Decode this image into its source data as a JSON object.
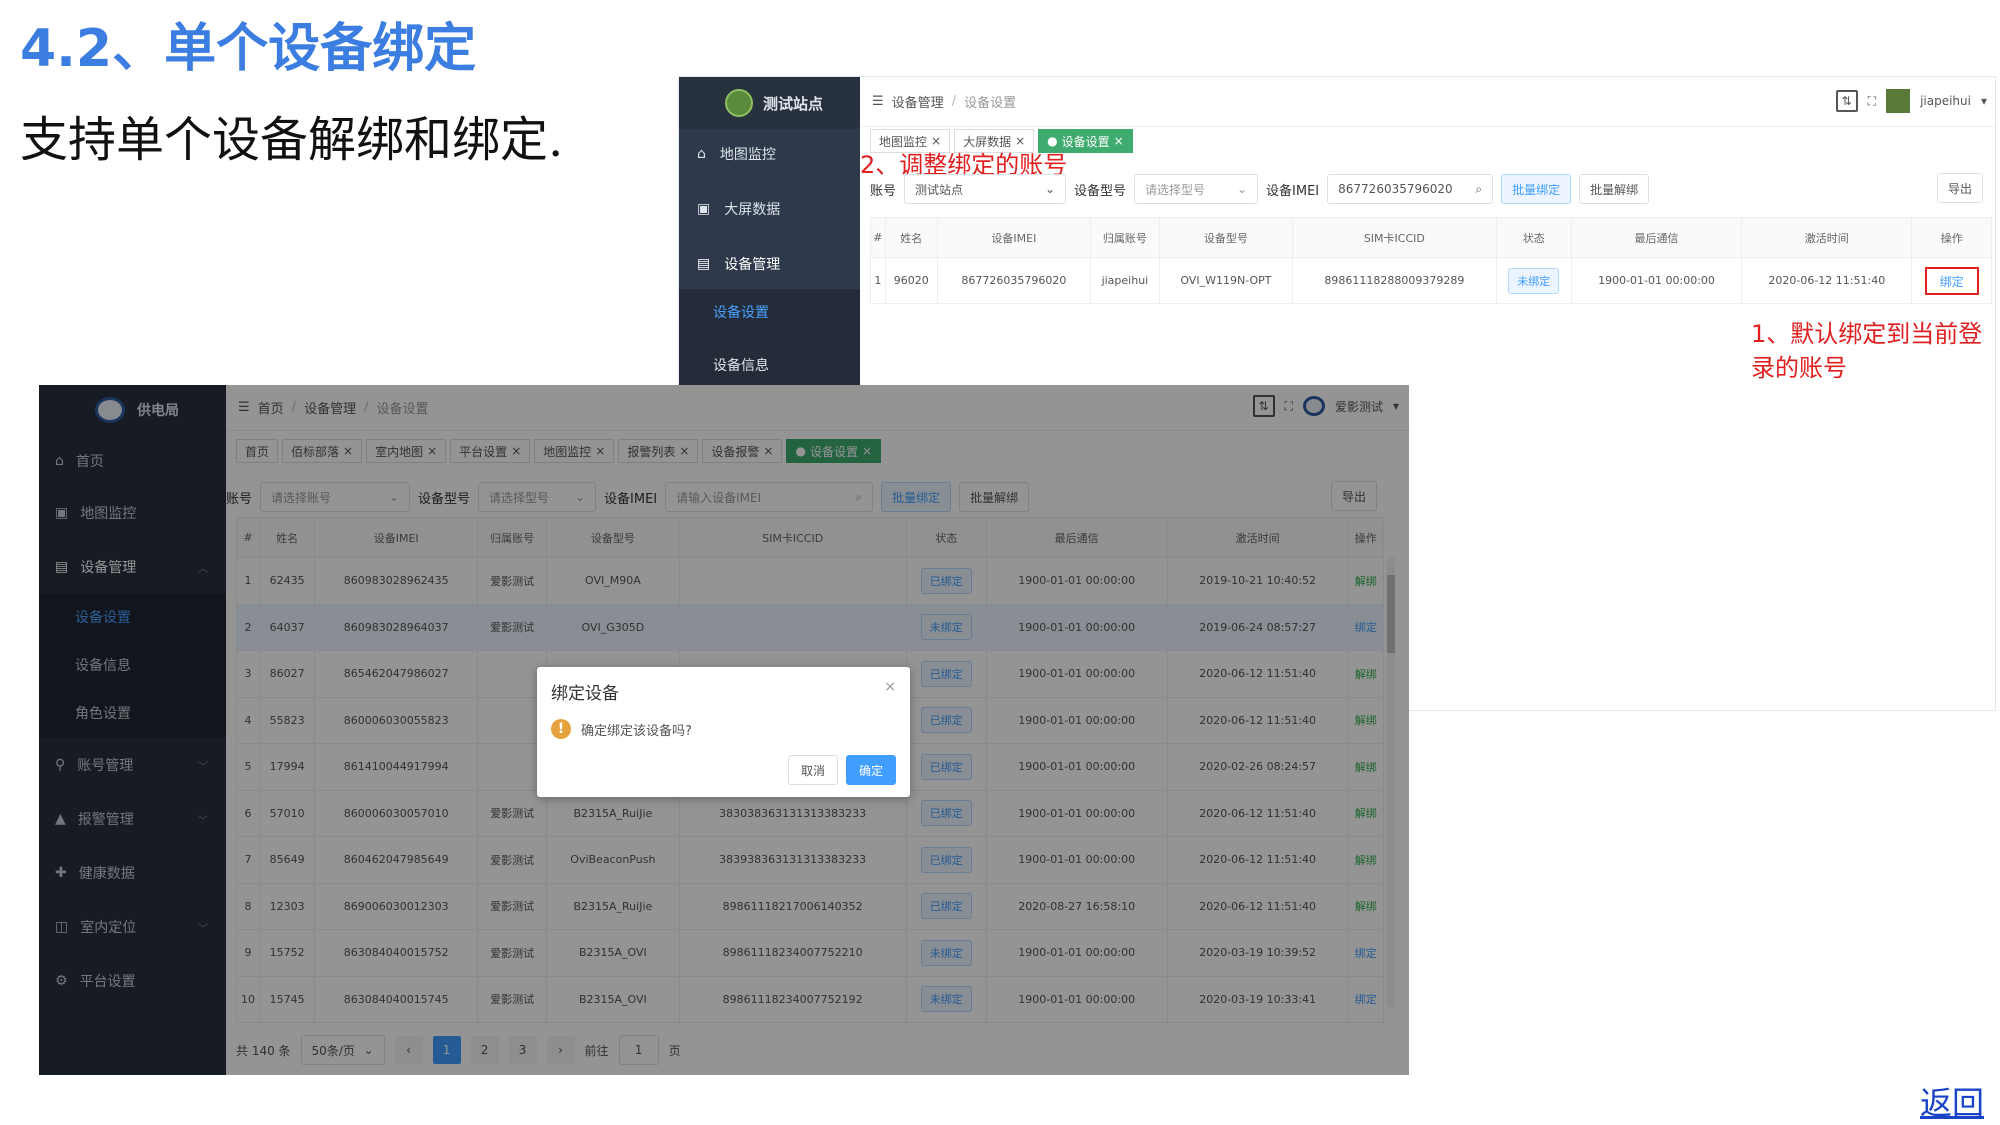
{
  "slide": {
    "title": "4.2、单个设备绑定",
    "subtitle": "支持单个设备解绑和绑定.",
    "back_link": "返回"
  },
  "shot1": {
    "logo_title": "测试站点",
    "menu": [
      "地图监控",
      "大屏数据",
      "设备管理"
    ],
    "submenu": [
      "设备设置",
      "设备信息"
    ],
    "breadcrumb": [
      "设备管理",
      "设备设置"
    ],
    "user": "jiapeihui",
    "tabs": [
      "地图监控",
      "大屏数据",
      "设备设置"
    ],
    "filter": {
      "account_label": "账号",
      "account_value": "测试站点",
      "model_label": "设备型号",
      "model_placeholder": "请选择型号",
      "imei_label": "设备IMEI",
      "imei_value": "867726035796020",
      "batch_bind": "批量绑定",
      "batch_unbind": "批量解绑",
      "export": "导出"
    },
    "columns": [
      "#",
      "姓名",
      "设备IMEI",
      "归属账号",
      "设备型号",
      "SIM卡ICCID",
      "状态",
      "最后通信",
      "激活时间",
      "操作"
    ],
    "rows": [
      [
        "1",
        "96020",
        "867726035796020",
        "jiapeihui",
        "OVI_W119N-OPT",
        "89861118288009379289",
        "未绑定",
        "1900-01-01 00:00:00",
        "2020-06-12 11:51:40",
        "绑定"
      ]
    ],
    "annotation_top": "2、调整绑定的账号",
    "annotation_right": "1、默认绑定到当前登录的账号"
  },
  "shot2": {
    "logo_title": "供电局",
    "menu": [
      "首页",
      "地图监控",
      "设备管理",
      "账号管理",
      "报警管理",
      "健康数据",
      "室内定位",
      "平台设置"
    ],
    "submenu": [
      "设备设置",
      "设备信息",
      "角色设置"
    ],
    "breadcrumb": [
      "首页",
      "设备管理",
      "设备设置"
    ],
    "user": "爱影测试",
    "tabs": [
      "首页",
      "佰标部落",
      "室内地图",
      "平台设置",
      "地图监控",
      "报警列表",
      "设备报警",
      "设备设置"
    ],
    "filter": {
      "account_label": "账号",
      "account_placeholder": "请选择账号",
      "model_label": "设备型号",
      "model_placeholder": "请选择型号",
      "imei_label": "设备IMEI",
      "imei_placeholder": "请输入设备IMEI",
      "batch_bind": "批量绑定",
      "batch_unbind": "批量解绑",
      "export": "导出"
    },
    "columns": [
      "#",
      "姓名",
      "设备IMEI",
      "归属账号",
      "设备型号",
      "SIM卡ICCID",
      "状态",
      "最后通信",
      "激活时间",
      "操作"
    ],
    "rows": [
      [
        "1",
        "62435",
        "860983028962435",
        "爱影测试",
        "OVI_M90A",
        "",
        "已绑定",
        "1900-01-01 00:00:00",
        "2019-10-21 10:40:52",
        "解绑"
      ],
      [
        "2",
        "64037",
        "860983028964037",
        "爱影测试",
        "OVI_G305D",
        "",
        "未绑定",
        "1900-01-01 00:00:00",
        "2019-06-24 08:57:27",
        "绑定"
      ],
      [
        "3",
        "86027",
        "865462047986027",
        "",
        "",
        "",
        "已绑定",
        "1900-01-01 00:00:00",
        "2020-06-12 11:51:40",
        "解绑"
      ],
      [
        "4",
        "55823",
        "860006030055823",
        "",
        "",
        "",
        "已绑定",
        "1900-01-01 00:00:00",
        "2020-06-12 11:51:40",
        "解绑"
      ],
      [
        "5",
        "17994",
        "861410044917994",
        "",
        "",
        "",
        "已绑定",
        "1900-01-01 00:00:00",
        "2020-02-26 08:24:57",
        "解绑"
      ],
      [
        "6",
        "57010",
        "860006030057010",
        "爱影测试",
        "B2315A_RuiJie",
        "383038363131313383233",
        "已绑定",
        "1900-01-01 00:00:00",
        "2020-06-12 11:51:40",
        "解绑"
      ],
      [
        "7",
        "85649",
        "860462047985649",
        "爱影测试",
        "OviBeaconPush",
        "383938363131313383233",
        "已绑定",
        "1900-01-01 00:00:00",
        "2020-06-12 11:51:40",
        "解绑"
      ],
      [
        "8",
        "12303",
        "869006030012303",
        "爱影测试",
        "B2315A_RuiJie",
        "89861118217006140352",
        "已绑定",
        "2020-08-27 16:58:10",
        "2020-06-12 11:51:40",
        "解绑"
      ],
      [
        "9",
        "15752",
        "863084040015752",
        "爱影测试",
        "B2315A_OVI",
        "89861118234007752210",
        "未绑定",
        "1900-01-01 00:00:00",
        "2020-03-19 10:39:52",
        "绑定"
      ],
      [
        "10",
        "15745",
        "863084040015745",
        "爱影测试",
        "B2315A_OVI",
        "89861118234007752192",
        "未绑定",
        "1900-01-01 00:00:00",
        "2020-03-19 10:33:41",
        "绑定"
      ]
    ],
    "pager": {
      "total": "共 140 条",
      "page_size": "50条/页",
      "pages": [
        "1",
        "2",
        "3"
      ],
      "goto_label": "前往",
      "goto_value": "1",
      "page_unit": "页"
    },
    "dialog": {
      "title": "绑定设备",
      "message": "确定绑定该设备吗?",
      "cancel": "取消",
      "confirm": "确定"
    }
  },
  "colors": {
    "title_blue": "#3b7de0",
    "sidebar_dark": "#2e3a4c",
    "primary": "#409eff",
    "tab_active_green": "#3fab6e",
    "annotation_red": "#e02020"
  }
}
